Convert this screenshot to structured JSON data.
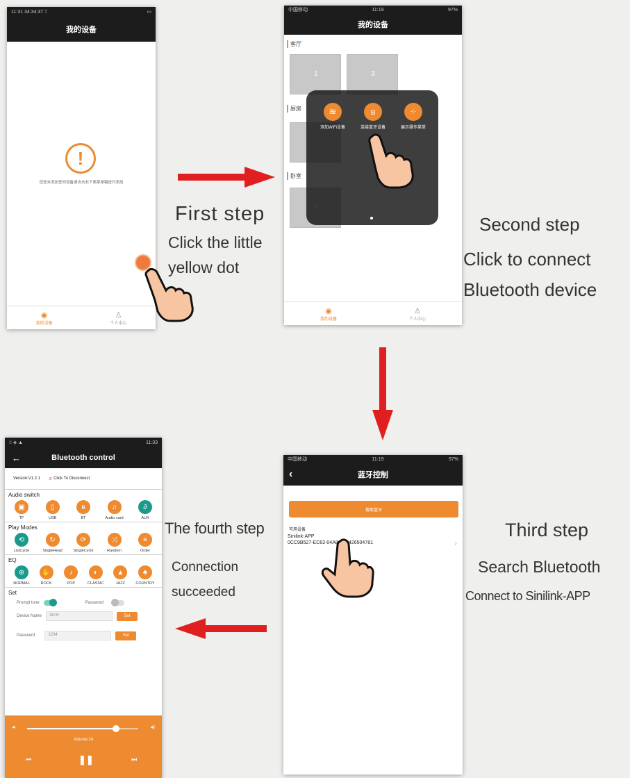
{
  "captions": {
    "step1_title": "First step",
    "step1_line1": "Click the little",
    "step1_line2": "yellow dot",
    "step2_title": "Second step",
    "step2_line1": "Click to connect",
    "step2_line2": "Bluetooth device",
    "step3_title": "Third step",
    "step3_line1": "Search Bluetooth",
    "step3_line2": "Connect to Sinilink-APP",
    "step4_title": "The fourth step",
    "step4_line1": "Connection",
    "step4_line2": "succeeded"
  },
  "phone1": {
    "status": "11:31 34:34:37 ⁞⁞",
    "title": "我的设备",
    "empty_text": "您还未添加任何设备请点击右下角菜单键进行添加",
    "tab_home": "我的设备",
    "tab_me": "个人中心"
  },
  "phone2": {
    "status_left": "中国移动",
    "status_time": "11:19",
    "status_right": "97%",
    "title": "我的设备",
    "room1": "客厅",
    "room2": "厨房",
    "room3": "卧室",
    "tile1": "1",
    "tile2": "3",
    "tile4": "4",
    "menu_wifi": "添加WiFi设备",
    "menu_bt": "连接蓝牙设备",
    "menu_show": "展示操作菜单",
    "tab_home": "我的设备",
    "tab_me": "个人中心"
  },
  "phone3": {
    "status_left": "中国移动",
    "status_time": "11:19",
    "status_right": "97%",
    "title": "蓝牙控制",
    "search_button": "搜索蓝牙",
    "available": "可用设备",
    "device_name": "Sinilink-APP",
    "device_id": "0CC9B527-EC62-04A8-6C8426504781"
  },
  "phone4": {
    "status_right": "11:33",
    "title": "Bluetooth control",
    "version": "Version:V1.2.1",
    "disconnect": "Click To Disconnect",
    "audio_switch": "Audio switch",
    "audio_items": [
      "TF",
      "USB",
      "BT",
      "Audio card",
      "AUX"
    ],
    "play_modes": "Play Modes",
    "mode_items": [
      "ListCycle",
      "SingleHead",
      "SingleCycle",
      "Random",
      "Order"
    ],
    "eq": "EQ",
    "eq_items": [
      "NORMAL",
      "ROCK",
      "POP",
      "CLASSIC",
      "JAZZ",
      "COUNTRY"
    ],
    "set": "Set",
    "prompt_tone": "Prompt tone",
    "password_label": "Password",
    "device_name_label": "Device Name",
    "device_name_value": "XinYi",
    "password_field_label": "Password",
    "password_value": "1234",
    "set_btn": "Set",
    "volume": "Volume:24",
    "volume_level": 0.8
  },
  "colors": {
    "accent": "#ee8a2f",
    "teal": "#1a9a8a",
    "arrow": "#e02020",
    "dark": "#1c1c1c"
  }
}
